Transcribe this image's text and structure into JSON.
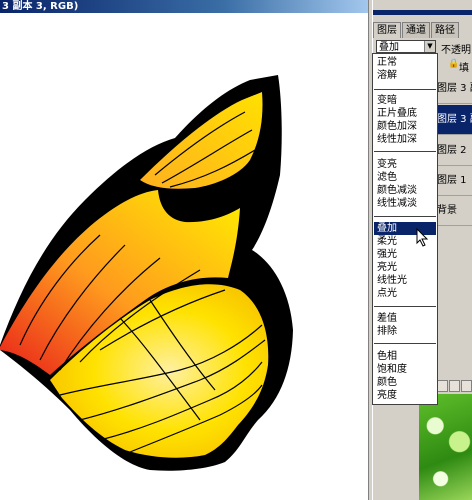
{
  "window": {
    "title": "3 副本 3, RGB)"
  },
  "layers_panel": {
    "tabs": [
      {
        "label": "图层",
        "active": true
      },
      {
        "label": "通道",
        "active": false
      },
      {
        "label": "路径",
        "active": false
      }
    ],
    "blend_mode": "叠加",
    "opacity_label": "不透明",
    "fill_label": "填",
    "layers": [
      {
        "name": "图层 3 副",
        "selected": false
      },
      {
        "name": "图层 3 副",
        "selected": true
      },
      {
        "name": "图层 2",
        "selected": false
      },
      {
        "name": "图层 1",
        "selected": false
      },
      {
        "name": "背景",
        "selected": false
      }
    ]
  },
  "blend_menu": {
    "groups": [
      [
        "正常",
        "溶解"
      ],
      [
        "变暗",
        "正片叠底",
        "颜色加深",
        "线性加深"
      ],
      [
        "变亮",
        "滤色",
        "颜色减淡",
        "线性减淡"
      ],
      [
        "叠加",
        "柔光",
        "强光",
        "亮光",
        "线性光",
        "点光"
      ],
      [
        "差值",
        "排除"
      ],
      [
        "色相",
        "饱和度",
        "颜色",
        "亮度"
      ]
    ],
    "highlighted": "叠加"
  },
  "colors": {
    "selection": "#0a246a",
    "panel_bg": "#d4d0c8",
    "wing_outline": "#000000",
    "wing_red": "#e8201a",
    "wing_orange": "#ff9a1e",
    "wing_yellow": "#ffee00"
  },
  "icons": [
    "lock-icon",
    "pointer-cursor-icon"
  ]
}
